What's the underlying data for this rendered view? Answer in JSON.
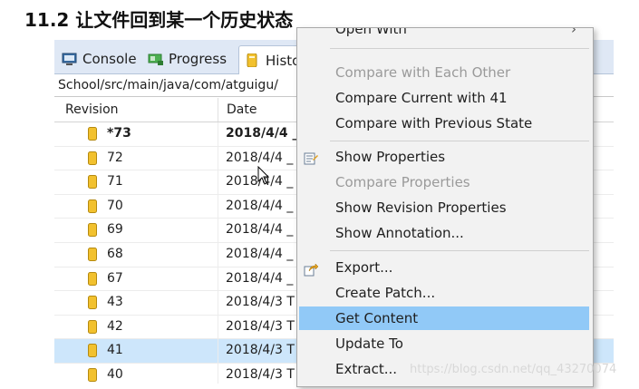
{
  "doc": {
    "title": "11.2 让文件回到某一个历史状态"
  },
  "tabs": [
    {
      "label": "Console",
      "icon": "console-icon"
    },
    {
      "label": "Progress",
      "icon": "progress-icon"
    },
    {
      "label": "Histo",
      "icon": "history-icon"
    }
  ],
  "path": "School/src/main/java/com/atguigu/",
  "table": {
    "columns": [
      "Revision",
      "Date"
    ],
    "rows": [
      {
        "revision": "*73",
        "date": "2018/4/4 _"
      },
      {
        "revision": "72",
        "date": "2018/4/4 _"
      },
      {
        "revision": "71",
        "date": "2018/4/4 _"
      },
      {
        "revision": "70",
        "date": "2018/4/4 _"
      },
      {
        "revision": "69",
        "date": "2018/4/4 _"
      },
      {
        "revision": "68",
        "date": "2018/4/4 _"
      },
      {
        "revision": "67",
        "date": "2018/4/4 _"
      },
      {
        "revision": "43",
        "date": "2018/4/3 T"
      },
      {
        "revision": "42",
        "date": "2018/4/3 T"
      },
      {
        "revision": "41",
        "date": "2018/4/3 T"
      },
      {
        "revision": "40",
        "date": "2018/4/3 T"
      }
    ]
  },
  "menu": {
    "partial_top": "Open With",
    "items": [
      {
        "label": "Compare with Each Other"
      },
      {
        "label": "Compare Current with 41"
      },
      {
        "label": "Compare with Previous State"
      },
      {
        "label": "Show Properties"
      },
      {
        "label": "Compare Properties"
      },
      {
        "label": "Show Revision Properties"
      },
      {
        "label": "Show Annotation..."
      },
      {
        "label": "Export..."
      },
      {
        "label": "Create Patch..."
      },
      {
        "label": "Get Content"
      },
      {
        "label": "Update To"
      },
      {
        "label": "Extract..."
      }
    ]
  },
  "watermark": "https://blog.csdn.net/qq_43270074",
  "colors": {
    "selection": "#cde6fb",
    "menu_highlight": "#91c9f7",
    "revision_icon": "#f2c12e"
  }
}
